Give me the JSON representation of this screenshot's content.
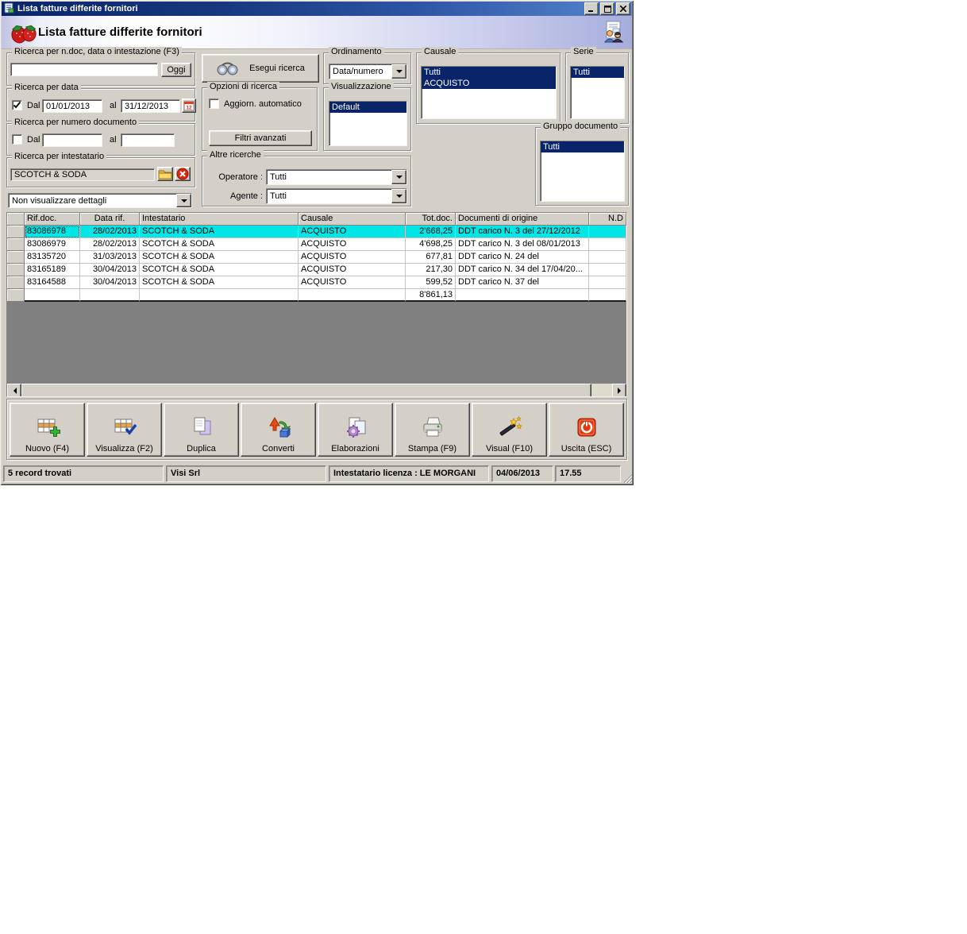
{
  "window": {
    "title": "Lista fatture differite fornitori"
  },
  "header": {
    "title": "Lista fatture differite fornitori"
  },
  "search_doc": {
    "group_label": "Ricerca per n.doc, data o intestazione (F3)",
    "value": "",
    "today_button": "Oggi"
  },
  "search_date": {
    "group_label": "Ricerca per data",
    "dal_label": "Dal",
    "dal_checked": true,
    "from_value": "01/01/2013",
    "al_label": "al",
    "to_value": "31/12/2013"
  },
  "search_number": {
    "group_label": "Ricerca per numero documento",
    "dal_label": "Dal",
    "dal_checked": false,
    "from_value": "",
    "al_label": "al",
    "to_value": ""
  },
  "search_holder": {
    "group_label": "Ricerca per intestatario",
    "value": "SCOTCH & SODA"
  },
  "details_combo": {
    "value": "Non visualizzare dettagli"
  },
  "actions": {
    "esegui_label": "Esegui ricerca",
    "filtri_label": "Filtri avanzati"
  },
  "opzioni": {
    "group_label": "Opzioni di ricerca",
    "auto_refresh_label": "Aggiorn. automatico",
    "auto_refresh_checked": false
  },
  "ordinamento": {
    "group_label": "Ordinamento",
    "value": "Data/numero"
  },
  "visualizzazione": {
    "group_label": "Visualizzazione",
    "items": [
      "Default"
    ],
    "selected": [
      0
    ]
  },
  "altre_ricerche": {
    "group_label": "Altre ricerche",
    "operatore_label": "Operatore :",
    "operatore_value": "Tutti",
    "agente_label": "Agente :",
    "agente_value": "Tutti"
  },
  "causale": {
    "group_label": "Causale",
    "items": [
      "Tutti",
      "ACQUISTO"
    ],
    "selected": [
      0,
      1
    ]
  },
  "serie": {
    "group_label": "Serie",
    "items": [
      "Tutti"
    ],
    "selected": [
      0
    ]
  },
  "gruppo_documento": {
    "group_label": "Gruppo documento",
    "items": [
      "Tutti"
    ],
    "selected": [
      0
    ]
  },
  "table": {
    "columns": [
      "Rif.doc.",
      "Data rif.",
      "Intestatario",
      "Causale",
      "Tot.doc.",
      "Documenti di origine",
      "N.D"
    ],
    "rows": [
      [
        "83086978",
        "28/02/2013",
        "SCOTCH & SODA",
        "ACQUISTO",
        "2'668,25",
        "DDT carico N. 3 del 27/12/2012",
        ""
      ],
      [
        "83086979",
        "28/02/2013",
        "SCOTCH & SODA",
        "ACQUISTO",
        "4'698,25",
        "DDT carico N. 3 del 08/01/2013",
        ""
      ],
      [
        "83135720",
        "31/03/2013",
        "SCOTCH & SODA",
        "ACQUISTO",
        "677,81",
        "DDT carico N. 24 del",
        ""
      ],
      [
        "83165189",
        "30/04/2013",
        "SCOTCH & SODA",
        "ACQUISTO",
        "217,30",
        "DDT carico N. 34 del 17/04/20...",
        ""
      ],
      [
        "83164588",
        "30/04/2013",
        "SCOTCH & SODA",
        "ACQUISTO",
        "599,52",
        "DDT carico N. 37 del",
        ""
      ]
    ],
    "selected_row": 0,
    "total_value": "8'861,13"
  },
  "toolbar": {
    "buttons": [
      {
        "label": "Nuovo (F4)",
        "icon": "grid-add-icon"
      },
      {
        "label": "Visualizza (F2)",
        "icon": "grid-check-icon"
      },
      {
        "label": "Duplica",
        "icon": "copy-icon"
      },
      {
        "label": "Converti",
        "icon": "convert-icon"
      },
      {
        "label": "Elaborazioni",
        "icon": "process-icon"
      },
      {
        "label": "Stampa (F9)",
        "icon": "printer-icon"
      },
      {
        "label": "Visual (F10)",
        "icon": "wand-icon"
      },
      {
        "label": "Uscita (ESC)",
        "icon": "power-icon"
      }
    ]
  },
  "statusbar": {
    "records": "5 record trovati",
    "company": "Visi Srl",
    "license": "Intestatario licenza : LE MORGANI",
    "date": "04/06/2013",
    "time": "17.55"
  },
  "colors": {
    "titlebar_start": "#0a246a",
    "titlebar_end": "#5585cd",
    "selected_row": "#00e6e6",
    "selection": "#0a246a",
    "window_bg": "#d4d0c8"
  }
}
